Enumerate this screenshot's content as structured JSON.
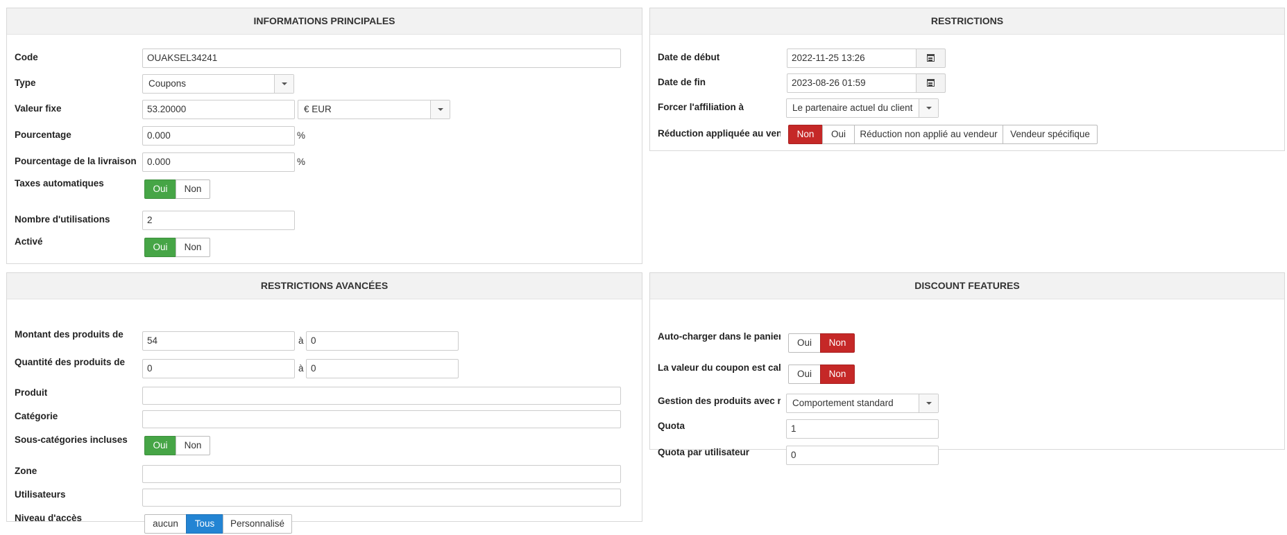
{
  "main_info": {
    "title": "INFORMATIONS PRINCIPALES",
    "code": {
      "label": "Code",
      "value": "OUAKSEL34241"
    },
    "type": {
      "label": "Type",
      "value": "Coupons"
    },
    "fixed_value": {
      "label": "Valeur fixe",
      "value": "53.20000",
      "currency": "€ EUR"
    },
    "percentage": {
      "label": "Pourcentage",
      "value": "0.000",
      "unit": "%"
    },
    "shipping_percentage": {
      "label": "Pourcentage de la livraison",
      "value": "0.000",
      "unit": "%"
    },
    "auto_taxes": {
      "label": "Taxes automatiques",
      "options": [
        "Oui",
        "Non"
      ],
      "selected": "Oui"
    },
    "uses": {
      "label": "Nombre d'utilisations",
      "value": "2"
    },
    "active": {
      "label": "Activé",
      "options": [
        "Oui",
        "Non"
      ],
      "selected": "Oui"
    }
  },
  "restrictions": {
    "title": "RESTRICTIONS",
    "start_date": {
      "label": "Date de début",
      "value": "2022-11-25 13:26"
    },
    "end_date": {
      "label": "Date de fin",
      "value": "2023-08-26 01:59"
    },
    "affiliation": {
      "label": "Forcer l'affiliation à",
      "value": "Le partenaire actuel du client"
    },
    "vendor_reduction": {
      "label": "Réduction appliquée au vendeur",
      "options": [
        "Non",
        "Oui",
        "Réduction non applié au vendeur",
        "Vendeur spécifique"
      ],
      "selected": "Non"
    }
  },
  "advanced": {
    "title": "RESTRICTIONS AVANCÉES",
    "amount": {
      "label": "Montant des produits de",
      "from": "54",
      "to_label": "à",
      "to": "0"
    },
    "quantity": {
      "label": "Quantité des produits de",
      "from": "0",
      "to_label": "à",
      "to": "0"
    },
    "product": {
      "label": "Produit",
      "value": ""
    },
    "category": {
      "label": "Catégorie",
      "value": ""
    },
    "subcategories": {
      "label": "Sous-catégories incluses",
      "options": [
        "Oui",
        "Non"
      ],
      "selected": "Oui"
    },
    "zone": {
      "label": "Zone",
      "value": ""
    },
    "users": {
      "label": "Utilisateurs",
      "value": ""
    },
    "access_level": {
      "label": "Niveau d'accès",
      "options": [
        "aucun",
        "Tous",
        "Personnalisé"
      ],
      "selected": "Tous"
    }
  },
  "discount_features": {
    "title": "DISCOUNT FEATURES",
    "auto_load": {
      "label": "Auto-charger dans le panier",
      "options": [
        "Oui",
        "Non"
      ],
      "selected": "Non"
    },
    "coupon_value": {
      "label": "La valeur du coupon est calculée",
      "options": [
        "Oui",
        "Non"
      ],
      "selected": "Non"
    },
    "discounted_products": {
      "label": "Gestion des produits avec réduction",
      "value": "Comportement standard"
    },
    "quota": {
      "label": "Quota",
      "value": "1"
    },
    "quota_per_user": {
      "label": "Quota par utilisateur",
      "value": "0"
    }
  },
  "colors": {
    "active_green": "#46a546",
    "active_red": "#c52827",
    "active_blue": "#2384d3"
  }
}
